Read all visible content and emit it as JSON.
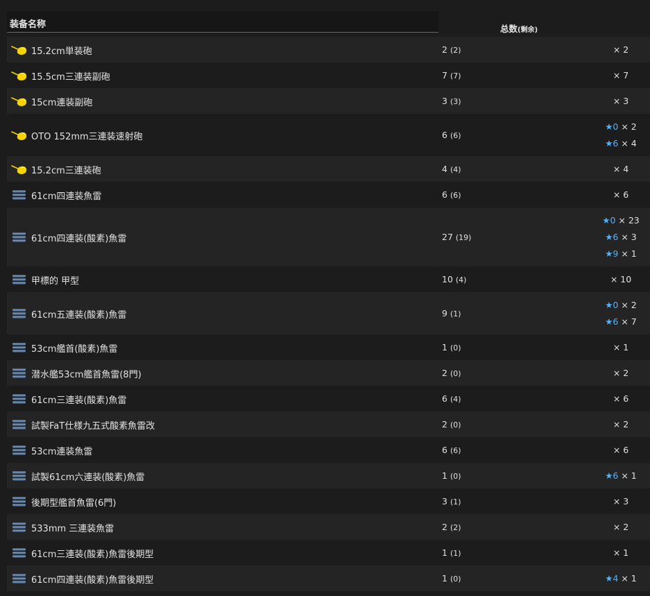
{
  "header": {
    "name_label": "装备名称",
    "total_label": "总数",
    "remain_label": "(剩余)"
  },
  "rows": [
    {
      "icon": "gun-icon",
      "name": "15.2cm単装砲",
      "total": "2",
      "remain": "(2)",
      "stars": [
        {
          "level": "",
          "count": "× 2"
        }
      ]
    },
    {
      "icon": "gun-icon",
      "name": "15.5cm三連装副砲",
      "total": "7",
      "remain": "(7)",
      "stars": [
        {
          "level": "",
          "count": "× 7"
        }
      ]
    },
    {
      "icon": "gun-icon",
      "name": "15cm連装副砲",
      "total": "3",
      "remain": "(3)",
      "stars": [
        {
          "level": "",
          "count": "× 3"
        }
      ]
    },
    {
      "icon": "gun-icon",
      "name": "OTO 152mm三連装速射砲",
      "total": "6",
      "remain": "(6)",
      "stars": [
        {
          "level": "★0",
          "count": " × 2"
        },
        {
          "level": "★6",
          "count": " × 4"
        }
      ]
    },
    {
      "icon": "gun-icon",
      "name": "15.2cm三連装砲",
      "total": "4",
      "remain": "(4)",
      "stars": [
        {
          "level": "",
          "count": "× 4"
        }
      ]
    },
    {
      "icon": "torpedo-icon",
      "name": "61cm四連装魚雷",
      "total": "6",
      "remain": "(6)",
      "stars": [
        {
          "level": "",
          "count": "× 6"
        }
      ]
    },
    {
      "icon": "torpedo-icon",
      "name": "61cm四連装(酸素)魚雷",
      "total": "27",
      "remain": "(19)",
      "stars": [
        {
          "level": "★0",
          "count": " × 23"
        },
        {
          "level": "★6",
          "count": " × 3"
        },
        {
          "level": "★9",
          "count": " × 1"
        }
      ]
    },
    {
      "icon": "torpedo-icon",
      "name": "甲標的 甲型",
      "total": "10",
      "remain": "(4)",
      "stars": [
        {
          "level": "",
          "count": "× 10"
        }
      ]
    },
    {
      "icon": "torpedo-icon",
      "name": "61cm五連装(酸素)魚雷",
      "total": "9",
      "remain": "(1)",
      "stars": [
        {
          "level": "★0",
          "count": " × 2"
        },
        {
          "level": "★6",
          "count": " × 7"
        }
      ]
    },
    {
      "icon": "torpedo-icon",
      "name": "53cm艦首(酸素)魚雷",
      "total": "1",
      "remain": "(0)",
      "stars": [
        {
          "level": "",
          "count": "× 1"
        }
      ]
    },
    {
      "icon": "torpedo-icon",
      "name": "潜水艦53cm艦首魚雷(8門)",
      "total": "2",
      "remain": "(0)",
      "stars": [
        {
          "level": "",
          "count": "× 2"
        }
      ]
    },
    {
      "icon": "torpedo-icon",
      "name": "61cm三連装(酸素)魚雷",
      "total": "6",
      "remain": "(4)",
      "stars": [
        {
          "level": "",
          "count": "× 6"
        }
      ]
    },
    {
      "icon": "torpedo-icon",
      "name": "試製FaT仕様九五式酸素魚雷改",
      "total": "2",
      "remain": "(0)",
      "stars": [
        {
          "level": "",
          "count": "× 2"
        }
      ]
    },
    {
      "icon": "torpedo-icon",
      "name": "53cm連装魚雷",
      "total": "6",
      "remain": "(6)",
      "stars": [
        {
          "level": "",
          "count": "× 6"
        }
      ]
    },
    {
      "icon": "torpedo-icon",
      "name": "試製61cm六連装(酸素)魚雷",
      "total": "1",
      "remain": "(0)",
      "stars": [
        {
          "level": "★6",
          "count": " × 1"
        }
      ]
    },
    {
      "icon": "torpedo-icon",
      "name": "後期型艦首魚雷(6門)",
      "total": "3",
      "remain": "(1)",
      "stars": [
        {
          "level": "",
          "count": "× 3"
        }
      ]
    },
    {
      "icon": "torpedo-icon",
      "name": "533mm 三連装魚雷",
      "total": "2",
      "remain": "(2)",
      "stars": [
        {
          "level": "",
          "count": "× 2"
        }
      ]
    },
    {
      "icon": "torpedo-icon",
      "name": "61cm三連装(酸素)魚雷後期型",
      "total": "1",
      "remain": "(1)",
      "stars": [
        {
          "level": "",
          "count": "× 1"
        }
      ]
    },
    {
      "icon": "torpedo-icon",
      "name": "61cm四連装(酸素)魚雷後期型",
      "total": "1",
      "remain": "(0)",
      "stars": [
        {
          "level": "★4",
          "count": " × 1"
        }
      ]
    }
  ],
  "colors": {
    "background": "#1c1c1c",
    "row_alt": "#242424",
    "star_accent": "#4fb4ff",
    "gun_icon": "#f5d400",
    "torpedo_icon": "#5b7fa8"
  }
}
